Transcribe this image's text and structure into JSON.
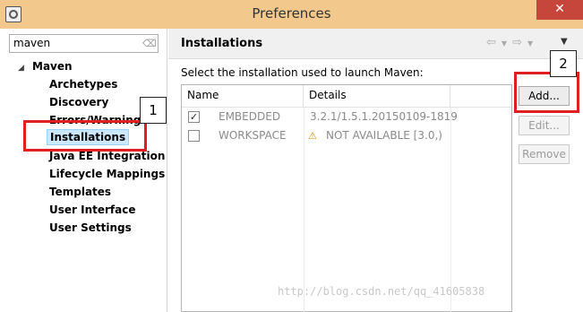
{
  "window": {
    "title": "Preferences",
    "close_glyph": "✕"
  },
  "filter": {
    "value": "maven",
    "clear_icon": "eraser-icon"
  },
  "tree": {
    "root": "Maven",
    "children": [
      "Archetypes",
      "Discovery",
      "Errors/Warnings",
      "Installations",
      "Java EE Integration",
      "Lifecycle Mappings",
      "Templates",
      "User Interface",
      "User Settings"
    ],
    "selected": "Installations"
  },
  "page": {
    "title": "Installations",
    "subtitle": "Select the installation used to launch Maven:"
  },
  "table": {
    "columns": [
      "Name",
      "Details"
    ],
    "rows": [
      {
        "checked": true,
        "check_glyph": "✓",
        "name": "EMBEDDED",
        "details": "3.2.1/1.5.1.20150109-1819",
        "warning": false
      },
      {
        "checked": false,
        "check_glyph": "",
        "name": "WORKSPACE",
        "details": "NOT AVAILABLE [3.0,)",
        "warning": true
      }
    ]
  },
  "buttons": {
    "add": "Add...",
    "edit": "Edit...",
    "remove": "Remove"
  },
  "annotations": {
    "badge1": "1",
    "badge2": "2",
    "highlight_color": "#e02020"
  },
  "watermark": "http://blog.csdn.net/qq_41605838"
}
